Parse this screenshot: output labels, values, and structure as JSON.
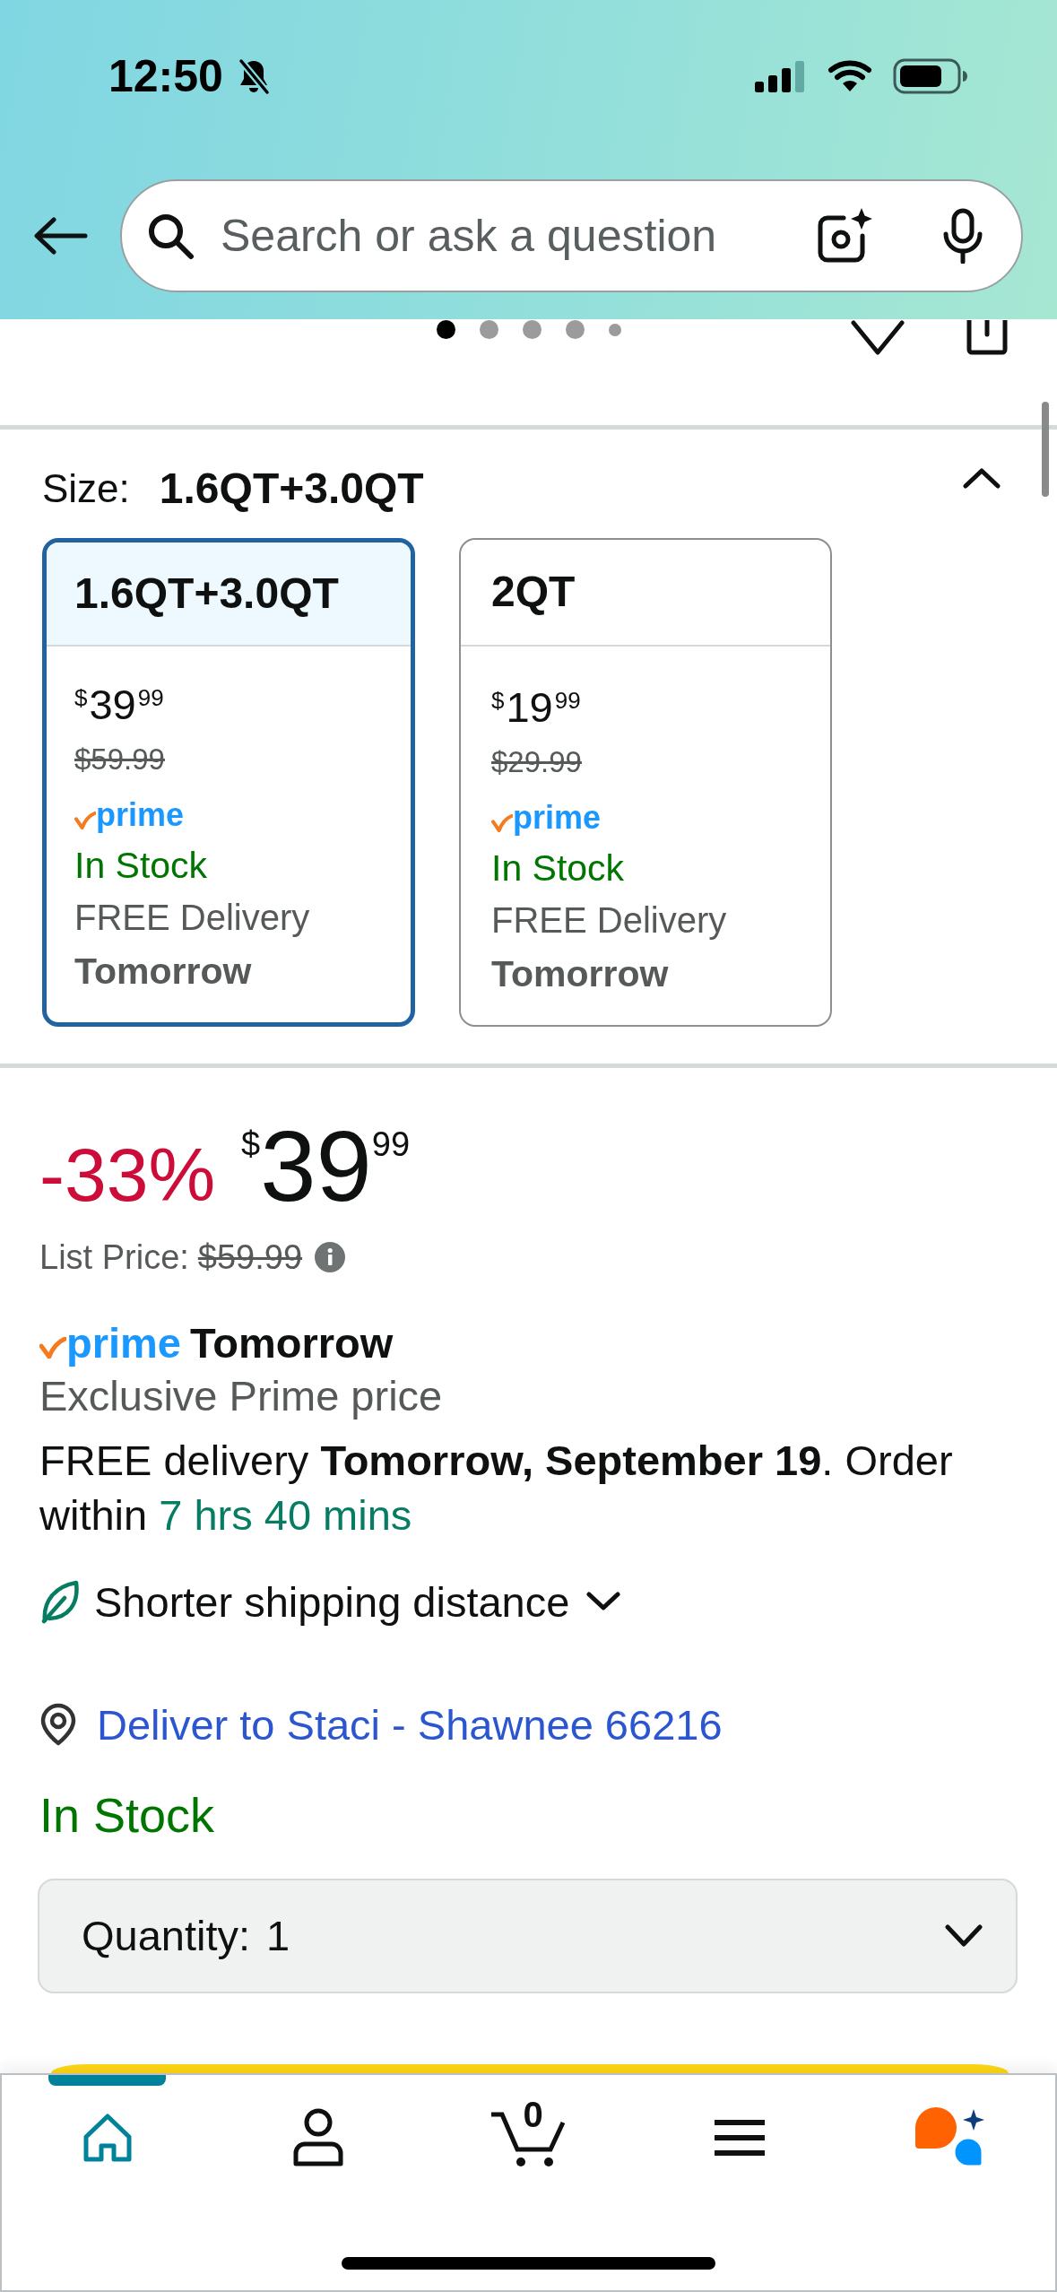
{
  "status_bar": {
    "time": "12:50",
    "silent": true
  },
  "header": {
    "search": {
      "placeholder": "Search or ask a question"
    }
  },
  "carousel": {
    "dots": [
      {
        "kind": "large",
        "selected": true
      },
      {
        "kind": "large",
        "selected": false
      },
      {
        "kind": "large",
        "selected": false
      },
      {
        "kind": "large",
        "selected": false
      },
      {
        "kind": "small",
        "selected": false
      }
    ]
  },
  "size": {
    "label": "Size:",
    "value": "1.6QT+3.0QT",
    "expanded": true,
    "options": [
      {
        "name": "1.6QT+3.0QT",
        "selected": true,
        "price": {
          "currency": "$",
          "whole": "39",
          "fraction": "99"
        },
        "list_price": "$59.99",
        "badge": "prime",
        "availability": "In Stock",
        "delivery": "FREE Delivery",
        "delivery_day": "Tomorrow"
      },
      {
        "name": "2QT",
        "selected": false,
        "price": {
          "currency": "$",
          "whole": "19",
          "fraction": "99"
        },
        "list_price": "$29.99",
        "badge": "prime",
        "availability": "In Stock",
        "delivery": "FREE Delivery",
        "delivery_day": "Tomorrow"
      }
    ]
  },
  "price": {
    "discount": "-33%",
    "currency": "$",
    "whole": "39",
    "fraction": "99",
    "list_label": "List Price:",
    "list_price": "$59.99"
  },
  "delivery": {
    "badge": "prime",
    "day": "Tomorrow",
    "note": "Exclusive Prime price",
    "text": "FREE delivery **Tomorrow, September 19**. Order within",
    "countdown": "7 hrs 40 mins"
  },
  "shipping_note": {
    "text": "Shorter shipping distance",
    "expanded": false
  },
  "deliver_to": "Deliver to Staci - Shawnee 66216",
  "availability": "In Stock",
  "quantity": {
    "label": "Quantity:",
    "value": "1"
  },
  "nav": [
    {
      "kind": "home",
      "selected": true
    },
    {
      "kind": "account",
      "selected": false
    },
    {
      "kind": "cart",
      "selected": false,
      "count": "0"
    },
    {
      "kind": "menu",
      "selected": false
    },
    {
      "kind": "assistant",
      "selected": false
    }
  ]
}
